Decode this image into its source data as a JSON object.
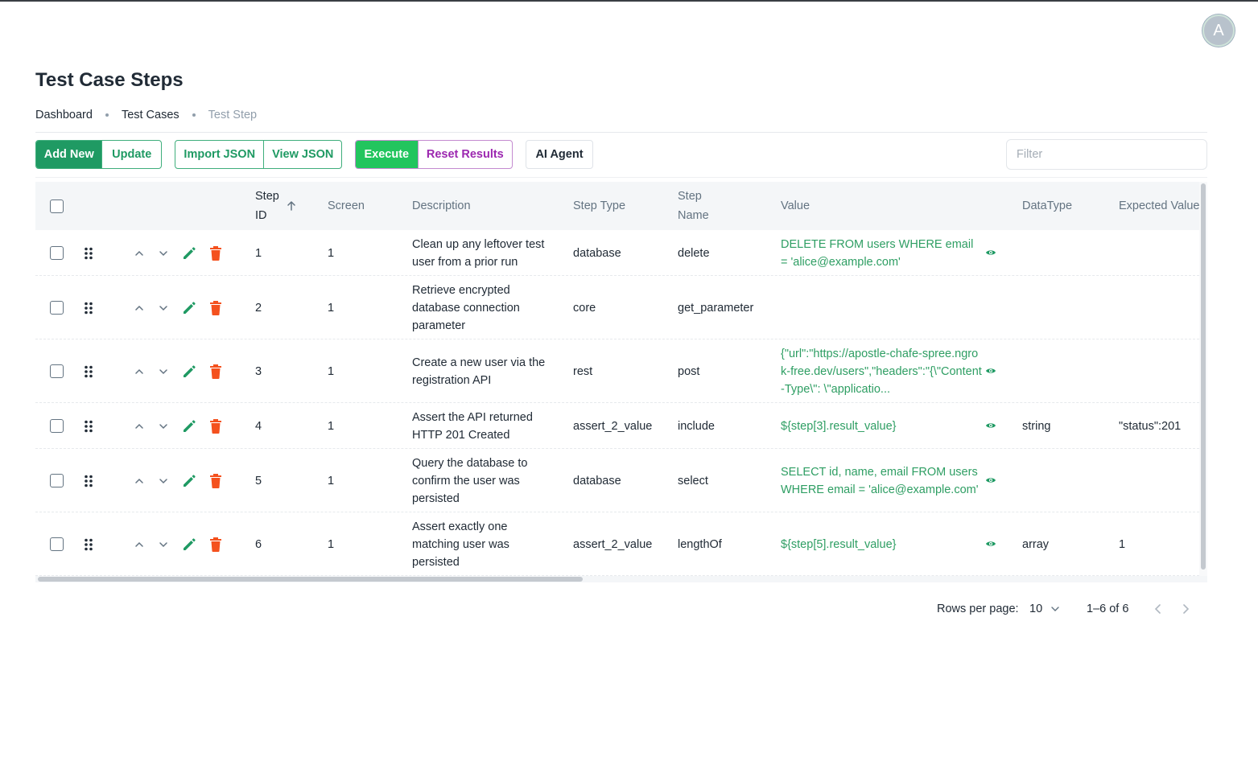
{
  "header": {
    "avatar_initial": "A",
    "title": "Test Case Steps"
  },
  "breadcrumb": [
    "Dashboard",
    "Test Cases",
    "Test Step"
  ],
  "toolbar": {
    "add_new": "Add New",
    "update": "Update",
    "import_json": "Import JSON",
    "view_json": "View JSON",
    "execute": "Execute",
    "reset_results": "Reset Results",
    "ai_agent": "AI Agent",
    "filter_placeholder": "Filter"
  },
  "table": {
    "headers": {
      "step_id": "Step ID",
      "screen": "Screen",
      "description": "Description",
      "step_type": "Step Type",
      "step_name": "Step Name",
      "value": "Value",
      "datatype": "DataType",
      "expected_value": "Expected Value"
    },
    "rows": [
      {
        "step_id": "1",
        "screen": "1",
        "description": "Clean up any leftover test user from a prior run",
        "step_type": "database",
        "step_name": "delete",
        "value": "DELETE FROM users WHERE email = 'alice@example.com'",
        "datatype": "",
        "expected_value": ""
      },
      {
        "step_id": "2",
        "screen": "1",
        "description": "Retrieve encrypted database connection parameter",
        "step_type": "core",
        "step_name": "get_parameter",
        "value": "",
        "datatype": "",
        "expected_value": ""
      },
      {
        "step_id": "3",
        "screen": "1",
        "description": "Create a new user via the registration API",
        "step_type": "rest",
        "step_name": "post",
        "value": "{\"url\":\"https://apostle-chafe-spree.ngrok-free.dev/users\",\"headers\":\"{\\\"Content-Type\\\": \\\"applicatio...",
        "datatype": "",
        "expected_value": ""
      },
      {
        "step_id": "4",
        "screen": "1",
        "description": "Assert the API returned HTTP 201 Created",
        "step_type": "assert_2_value",
        "step_name": "include",
        "value": "${step[3].result_value}",
        "datatype": "string",
        "expected_value": "\"status\":201"
      },
      {
        "step_id": "5",
        "screen": "1",
        "description": "Query the database to confirm the user was persisted",
        "step_type": "database",
        "step_name": "select",
        "value": "SELECT id, name, email FROM users WHERE email = 'alice@example.com'",
        "datatype": "",
        "expected_value": ""
      },
      {
        "step_id": "6",
        "screen": "1",
        "description": "Assert exactly one matching user was persisted",
        "step_type": "assert_2_value",
        "step_name": "lengthOf",
        "value": "${step[5].result_value}",
        "datatype": "array",
        "expected_value": "1"
      }
    ]
  },
  "pagination": {
    "rows_per_page_label": "Rows per page:",
    "rows_per_page": "10",
    "range": "1–6 of 6"
  },
  "colors": {
    "primary_green": "#1f9a63",
    "execute_green": "#22c55e",
    "purple": "#9c27b0",
    "delete_red": "#f4511e"
  }
}
